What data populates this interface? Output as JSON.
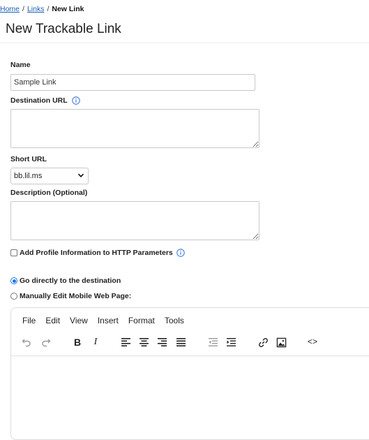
{
  "breadcrumb": {
    "home": "Home",
    "links": "Links",
    "current": "New Link",
    "separator": "/"
  },
  "page": {
    "title": "New Trackable Link"
  },
  "form": {
    "name": {
      "label": "Name",
      "value": "Sample Link"
    },
    "destination_url": {
      "label": "Destination URL",
      "value": ""
    },
    "short_url": {
      "label": "Short URL",
      "selected": "bb.lil.ms"
    },
    "description": {
      "label": "Description (Optional)",
      "value": ""
    },
    "profile_info": {
      "label": "Add Profile Information to HTTP Parameters",
      "checked": false
    },
    "destination_mode": {
      "go_direct": {
        "label": "Go directly to the destination",
        "checked": true
      },
      "manual_edit": {
        "label": "Manually Edit Mobile Web Page:",
        "checked": false
      }
    }
  },
  "editor": {
    "menus": [
      "File",
      "Edit",
      "View",
      "Insert",
      "Format",
      "Tools"
    ],
    "toolbar_icons": [
      "undo-icon",
      "redo-icon",
      "bold-icon",
      "italic-icon",
      "align-left-icon",
      "align-center-icon",
      "align-right-icon",
      "align-justify-icon",
      "outdent-icon",
      "indent-icon",
      "link-icon",
      "image-icon",
      "code-icon"
    ],
    "bold_glyph": "B",
    "italic_glyph": "I",
    "code_glyph": "<>"
  },
  "colors": {
    "link": "#1a5fb4",
    "accent": "#1a73e8",
    "icon": "#2f6fd6"
  }
}
